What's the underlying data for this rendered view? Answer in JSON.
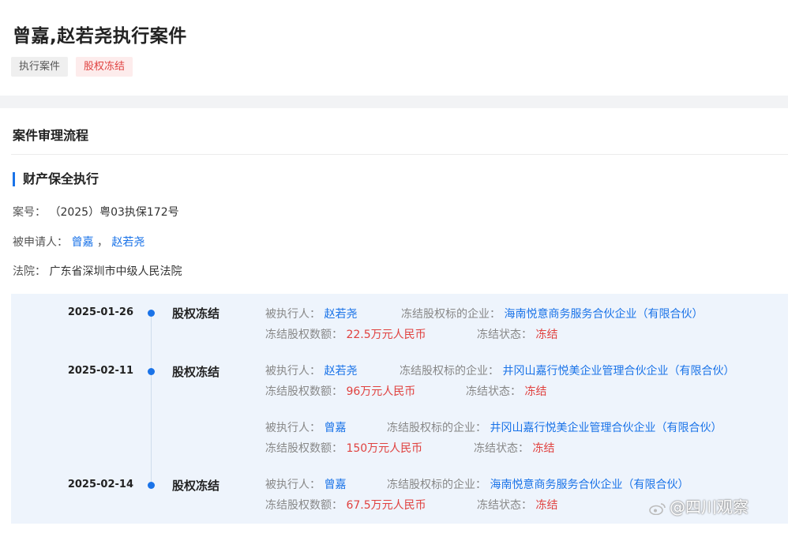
{
  "header": {
    "title": "曾嘉,赵若尧执行案件",
    "tags": [
      "执行案件",
      "股权冻结"
    ]
  },
  "process": {
    "section_title": "案件审理流程",
    "sub_title": "财产保全执行",
    "case_no_label": "案号：",
    "case_no": "（2025）粤03执保172号",
    "respondent_label": "被申请人：",
    "respondent_1": "曾嘉",
    "respondent_sep": "，",
    "respondent_2": "赵若尧",
    "court_label": "法院：",
    "court": "广东省深圳市中级人民法院"
  },
  "labels": {
    "executed": "被执行人：",
    "company": "冻结股权标的企业：",
    "amount": "冻结股权数额：",
    "status": "冻结状态："
  },
  "timeline": [
    {
      "date": "2025-01-26",
      "type": "股权冻结",
      "records": [
        {
          "person": "赵若尧",
          "company": "海南悦意商务服务合伙企业（有限合伙）",
          "amount": "22.5万元人民币",
          "status": "冻结"
        }
      ]
    },
    {
      "date": "2025-02-11",
      "type": "股权冻结",
      "records": [
        {
          "person": "赵若尧",
          "company": "井冈山嘉行悦美企业管理合伙企业（有限合伙）",
          "amount": "96万元人民币",
          "status": "冻结"
        },
        {
          "person": "曾嘉",
          "company": "井冈山嘉行悦美企业管理合伙企业（有限合伙）",
          "amount": "150万元人民币",
          "status": "冻结"
        }
      ]
    },
    {
      "date": "2025-02-14",
      "type": "股权冻结",
      "records": [
        {
          "person": "曾嘉",
          "company": "海南悦意商务服务合伙企业（有限合伙）",
          "amount": "67.5万元人民币",
          "status": "冻结"
        }
      ]
    }
  ],
  "watermark": "@四川观察",
  "colors": {
    "accent": "#1a73e8",
    "alert": "#e0413f",
    "timeline_bg": "#eef4fc"
  }
}
